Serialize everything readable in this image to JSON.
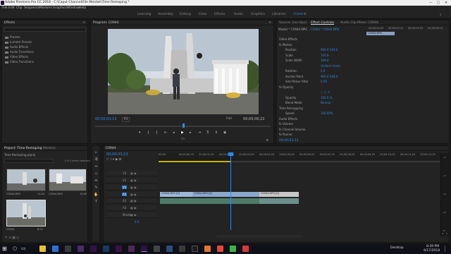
{
  "window": {
    "title": "Adobe Premiere Pro CC 2018 - C:\\Caput Channel\\File Mentah\\Time Remaping *",
    "min": "—",
    "max": "▢",
    "close": "✕"
  },
  "menu": [
    "File",
    "Edit",
    "Clip",
    "Sequence",
    "Markers",
    "Graphics",
    "Window",
    "Help"
  ],
  "workspaces": [
    {
      "label": "Learning",
      "active": false
    },
    {
      "label": "Assembly",
      "active": false
    },
    {
      "label": "Editing",
      "active": false
    },
    {
      "label": "Color",
      "active": false
    },
    {
      "label": "Effects",
      "active": false
    },
    {
      "label": "Audio",
      "active": false
    },
    {
      "label": "Graphics",
      "active": false
    },
    {
      "label": "Libraries",
      "active": false
    },
    {
      "label": "Cinem",
      "active": true
    }
  ],
  "effects_panel": {
    "title": "Effects",
    "items": [
      "Presets",
      "Lumetri Presets",
      "Audio Effects",
      "Audio Transitions",
      "Video Effects",
      "Video Transitions"
    ]
  },
  "program_monitor": {
    "title": "Program: C0944",
    "timecode_current": "00;00;03;13",
    "fit": "Fit",
    "quality": "Full",
    "timecode_duration": "00;00;06;22"
  },
  "effect_controls": {
    "tabs": [
      "Source: (no clips)",
      "Effect Controls",
      "Audio Clip Mixer: C0944"
    ],
    "master_label": "Master * C0944.MP4",
    "clip_label": "C0944 * C0944.MP4",
    "mini_clip": "C0944.MP4",
    "ruler_labels": [
      "00;00;04;29",
      "00;00;05;14",
      "00;00;05;29",
      "00;00;06;14"
    ],
    "rows": [
      {
        "label": "Video Effects",
        "value": ""
      },
      {
        "label": "fx  Motion",
        "value": ""
      },
      {
        "label": "Position",
        "value": "960.0   540.0"
      },
      {
        "label": "Scale",
        "value": "100.0"
      },
      {
        "label": "Scale Width",
        "value": "100.0"
      },
      {
        "label": "",
        "value": "Uniform Scale"
      },
      {
        "label": "Rotation",
        "value": "0.0"
      },
      {
        "label": "Anchor Point",
        "value": "960.0   540.0"
      },
      {
        "label": "Anti-flicker Filter",
        "value": "0.00"
      },
      {
        "label": "fx  Opacity",
        "value": ""
      },
      {
        "label": "",
        "value": "○ ▢ ✎"
      },
      {
        "label": "Opacity",
        "value": "100.0 %"
      },
      {
        "label": "Blend Mode",
        "value": "Normal"
      },
      {
        "label": "Time Remapping",
        "value": ""
      },
      {
        "label": "Speed",
        "value": "100.00%"
      },
      {
        "label": "Audio Effects",
        "value": ""
      },
      {
        "label": "fx  Volume",
        "value": ""
      },
      {
        "label": "fx  Channel Volume",
        "value": ""
      },
      {
        "label": "fx  Panner",
        "value": ""
      }
    ],
    "footer_timecode": "00;00;03;13"
  },
  "project_panel": {
    "tabs": [
      "Project: Time Remaping",
      "Markers"
    ],
    "folder": "Time Remaping.prproj",
    "selection": "1 of 3 items selected",
    "clips": [
      {
        "name": "C0944.MP4",
        "duration": "11;24"
      },
      {
        "name": "C0944.MP4",
        "duration": "15;05"
      },
      {
        "name": "C0944",
        "duration": "6;22"
      }
    ]
  },
  "timeline": {
    "tab": "C0944",
    "timecode": "00;00;03;13",
    "ruler": [
      "00;00",
      "00;00;00;29",
      "00;00;01;29",
      "00;00;02;29",
      "00;00;03;29",
      "00;00;04;29",
      "00;00;05;29",
      "00;00;06;29",
      "00;00;07;29",
      "00;00;08;29",
      "00;00;09;29",
      "00;00;10;29",
      "00;00;11;29",
      "00;00;12;29"
    ],
    "tracks": [
      "V3",
      "V2",
      "V1",
      "A1",
      "A2",
      "A3",
      "Master"
    ],
    "master_value": "0.0",
    "video_clips": [
      "C0944.MP4 [V]",
      "C0944.MP4 [V]",
      "C0944.MP4 [V]"
    ],
    "db_scale": [
      "-12",
      "-24",
      "-36",
      "-48",
      "dB"
    ],
    "solo": [
      "S",
      "S"
    ]
  },
  "taskbar": {
    "desktop": "Desktop",
    "time": "8:39 PM",
    "date": "9/17/2018"
  },
  "colors": {
    "accent": "#2d8ceb",
    "clip_video": "#9bb8d8",
    "clip_audio": "#4d7b6a"
  }
}
